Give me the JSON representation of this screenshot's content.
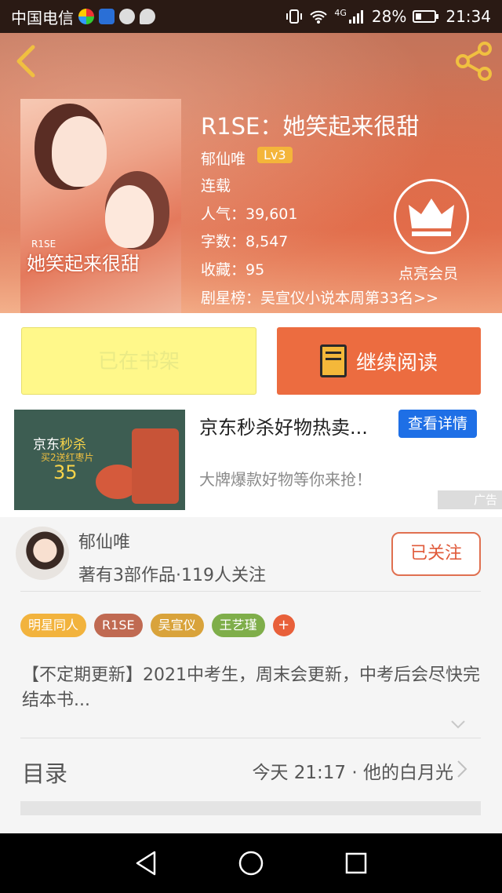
{
  "status_bar": {
    "carrier": "中国电信",
    "network": "4G",
    "battery": "28%",
    "time": "21:34"
  },
  "header": {
    "title": "R1SE：她笑起来很甜",
    "author": "郁仙唯",
    "level": "Lv3",
    "status": "连载",
    "popularity": "人气：39,601",
    "word_count": "字数：8,547",
    "favorites": "收藏：95",
    "ranking": "剧星榜：吴宣仪小说本周第33名>>",
    "vip_label": "点亮会员",
    "cover": {
      "en_title": "R1SE",
      "cn_title": "她笑起来很甜"
    },
    "icons": [
      "back-icon",
      "share-icon",
      "crown-icon"
    ]
  },
  "actions": {
    "shelf_label": "已在书架",
    "read_label": "继续阅读"
  },
  "ad": {
    "title": "京东秒杀好物热卖...",
    "detail_label": "查看详情",
    "subtitle": "大牌爆款好物等你来抢！",
    "tag": "广告",
    "image": {
      "line1a": "京东",
      "line1b": "秒杀",
      "line2": "买2送红枣片",
      "price": "35"
    }
  },
  "author_card": {
    "name": "郁仙唯",
    "stats": "著有3部作品·119人关注",
    "follow_label": "已关注"
  },
  "tags": [
    {
      "label": "明星同人",
      "color": "#f2b33d"
    },
    {
      "label": "R1SE",
      "color": "#c06a52"
    },
    {
      "label": "吴宣仪",
      "color": "#d9a33b"
    },
    {
      "label": "王艺瑾",
      "color": "#7fae4a"
    }
  ],
  "tag_plus": "+",
  "description": "【不定期更新】2021中考生，周末会更新，中考后会尽快完结本书...",
  "toc": {
    "label": "目录",
    "latest": "今天 21:17 · 他的白月光"
  },
  "colors": {
    "accent": "#ec6c40",
    "shelf_bg": "#fff88a",
    "ad_button": "#1e6fe6"
  }
}
